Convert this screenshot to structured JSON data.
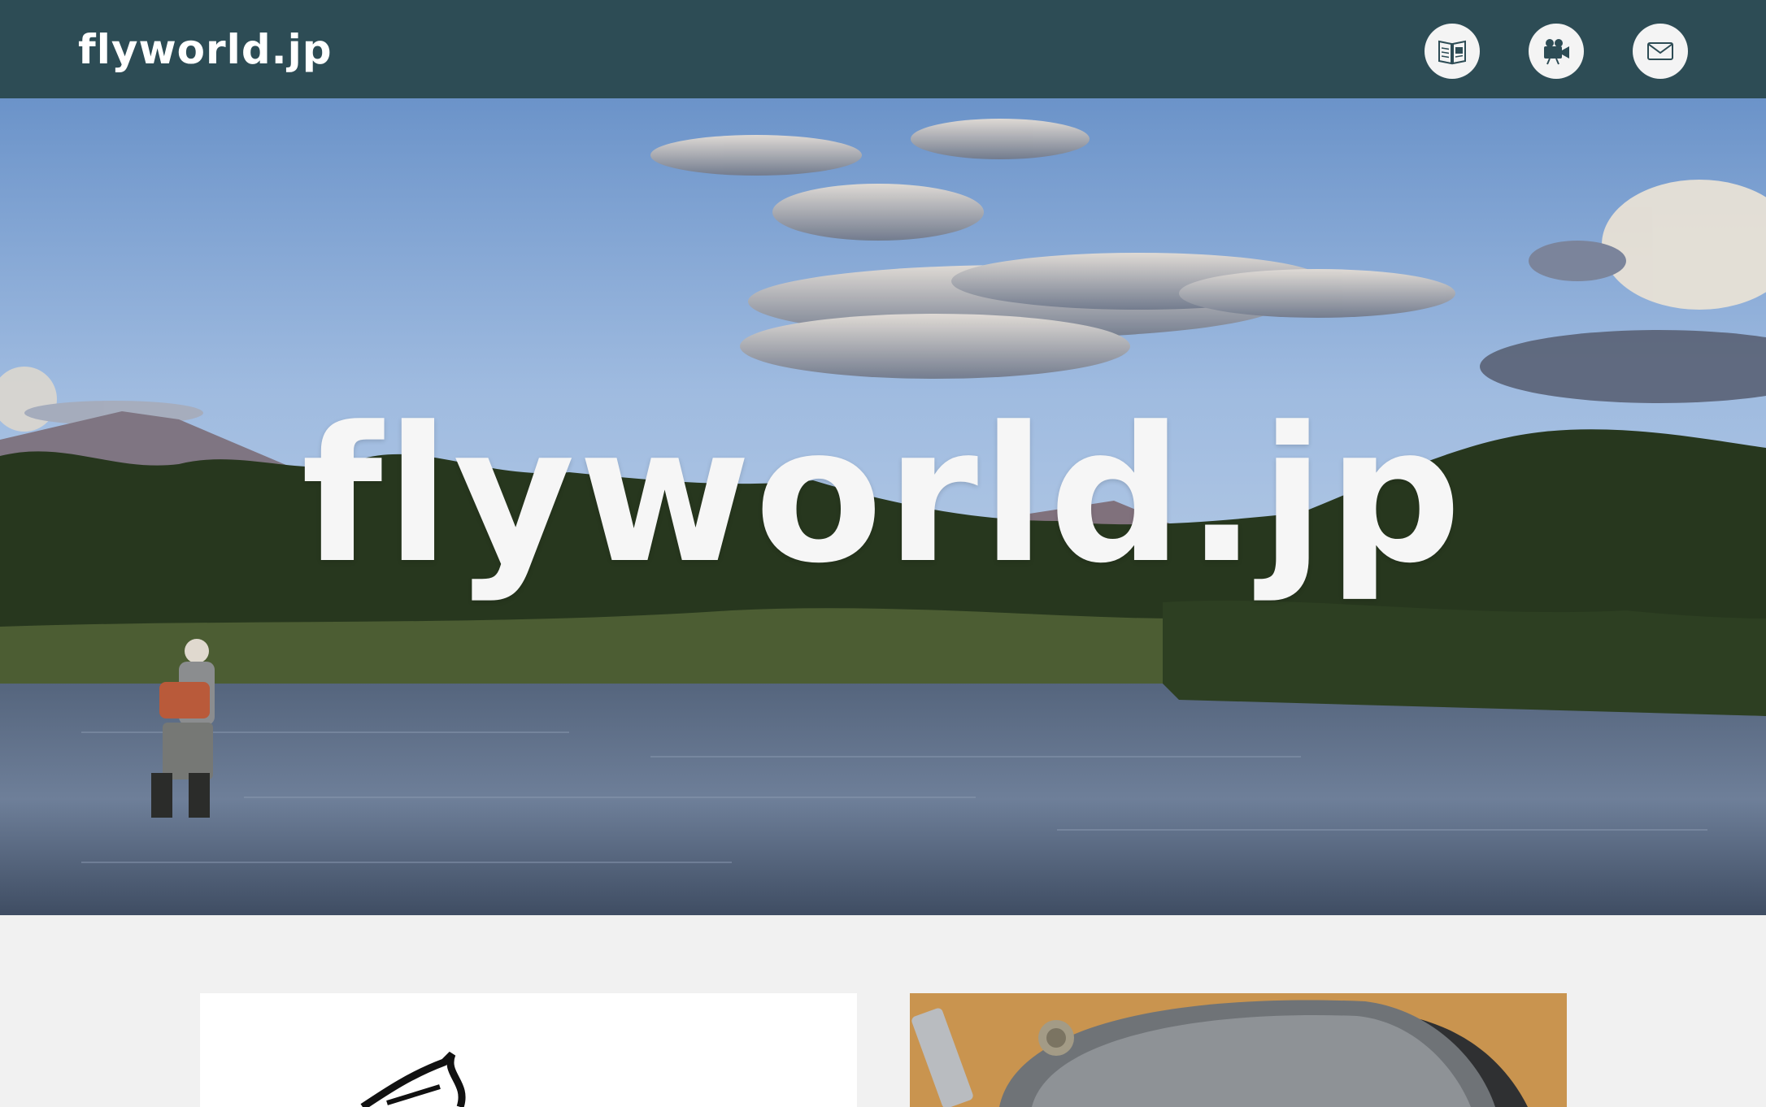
{
  "header": {
    "brand": "flyworld.jp",
    "nav": [
      {
        "name": "magazine-icon"
      },
      {
        "name": "video-camera-icon"
      },
      {
        "name": "mail-icon"
      }
    ],
    "background_color": "#2d4c55"
  },
  "hero": {
    "title": "flyworld.jp"
  },
  "colors": {
    "page_bg": "#f1f1f1",
    "text_light": "#f6f6f6"
  }
}
